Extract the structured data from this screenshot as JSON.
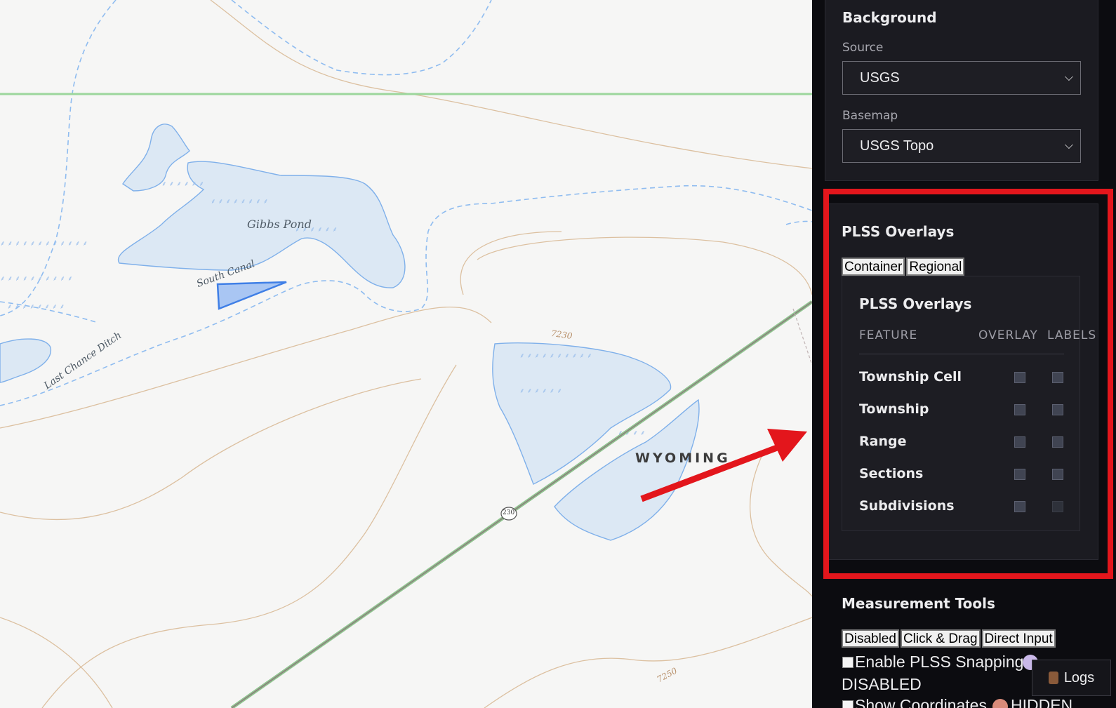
{
  "map": {
    "labels": {
      "gibbs_pond": "Gibbs Pond",
      "south_canal": "South Canal",
      "last_chance_ditch": "Last Chance Ditch",
      "wyoming": "WYOMING",
      "contour_7230": "7230",
      "contour_7250": "7250",
      "route_230": "230"
    }
  },
  "background": {
    "title": "Background",
    "source_label": "Source",
    "source_value": "USGS",
    "basemap_label": "Basemap",
    "basemap_value": "USGS Topo"
  },
  "plss": {
    "title": "PLSS Overlays",
    "tabs": [
      "Container",
      "Regional"
    ],
    "inner_title": "PLSS Overlays",
    "columns": {
      "feature": "FEATURE",
      "overlay": "OVERLAY",
      "labels": "LABELS"
    },
    "rows": [
      {
        "name": "Township Cell",
        "overlay": false,
        "labels": false
      },
      {
        "name": "Township",
        "overlay": false,
        "labels": false
      },
      {
        "name": "Range",
        "overlay": false,
        "labels": false
      },
      {
        "name": "Sections",
        "overlay": false,
        "labels": false
      },
      {
        "name": "Subdivisions",
        "overlay": false,
        "labels": false
      }
    ]
  },
  "measurement": {
    "title": "Measurement Tools",
    "modes": [
      "Disabled",
      "Click & Drag",
      "Direct Input"
    ],
    "snapping_label": "Enable PLSS Snapping",
    "snapping_status": "DISABLED",
    "coordinates_label": "Show Coordinates",
    "coordinates_status": "HIDDEN"
  },
  "logs": {
    "label": "Logs",
    "icon": "log-icon"
  },
  "colors": {
    "highlight": "#e3161c",
    "panel_bg": "#0c0c10",
    "water": "#dce8f4",
    "contour": "#d9b48c"
  }
}
